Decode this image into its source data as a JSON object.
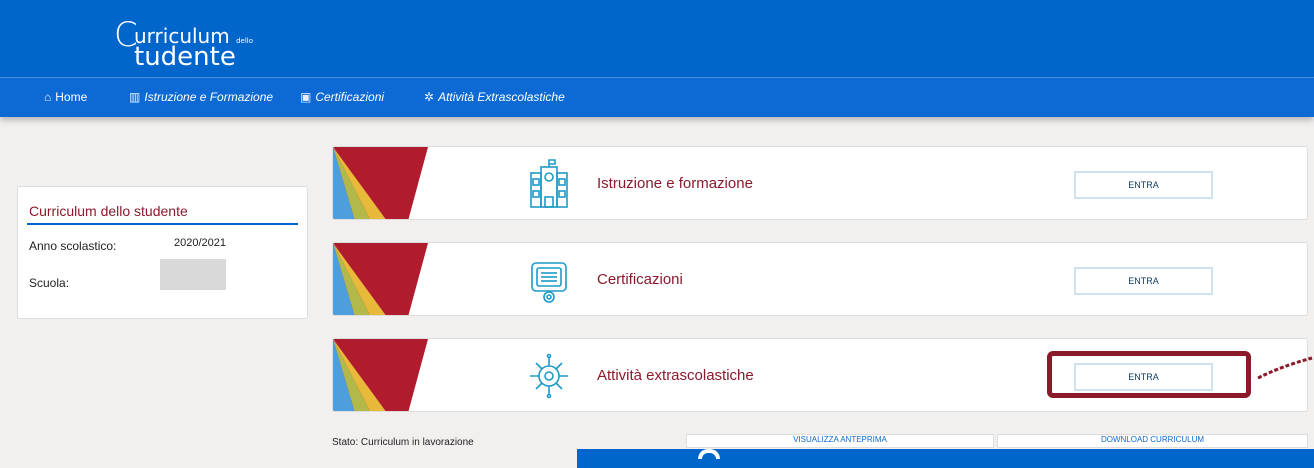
{
  "brand": {
    "logo_glyph": "C",
    "logo_line1": "urriculum",
    "logo_small": "dello",
    "logo_line2": "tudente"
  },
  "nav": {
    "home": "Home",
    "istruzione": "Istruzione e Formazione",
    "certificazioni": "Certificazioni",
    "attivita": "Attività Extrascolastiche"
  },
  "sidebar": {
    "title": "Curriculum dello studente",
    "anno_label": "Anno scolastico:",
    "anno_value": "2020/2021",
    "scuola_label": "Scuola:"
  },
  "panels": [
    {
      "title": "Istruzione e formazione",
      "button": "ENTRA",
      "icon": "school-building-icon"
    },
    {
      "title": "Certificazioni",
      "button": "ENTRA",
      "icon": "certificate-icon"
    },
    {
      "title": "Attività extrascolastiche",
      "button": "ENTRA",
      "icon": "virus-activity-icon"
    }
  ],
  "status": {
    "label": "Stato: Curriculum in lavorazione",
    "preview": "VISUALIZZA ANTEPRIMA",
    "download": "DOWNLOAD CURRICULUM"
  },
  "colors": {
    "primary_blue": "#0066cc",
    "title_red": "#8b1a2b",
    "highlight": "#8b1a2b"
  }
}
